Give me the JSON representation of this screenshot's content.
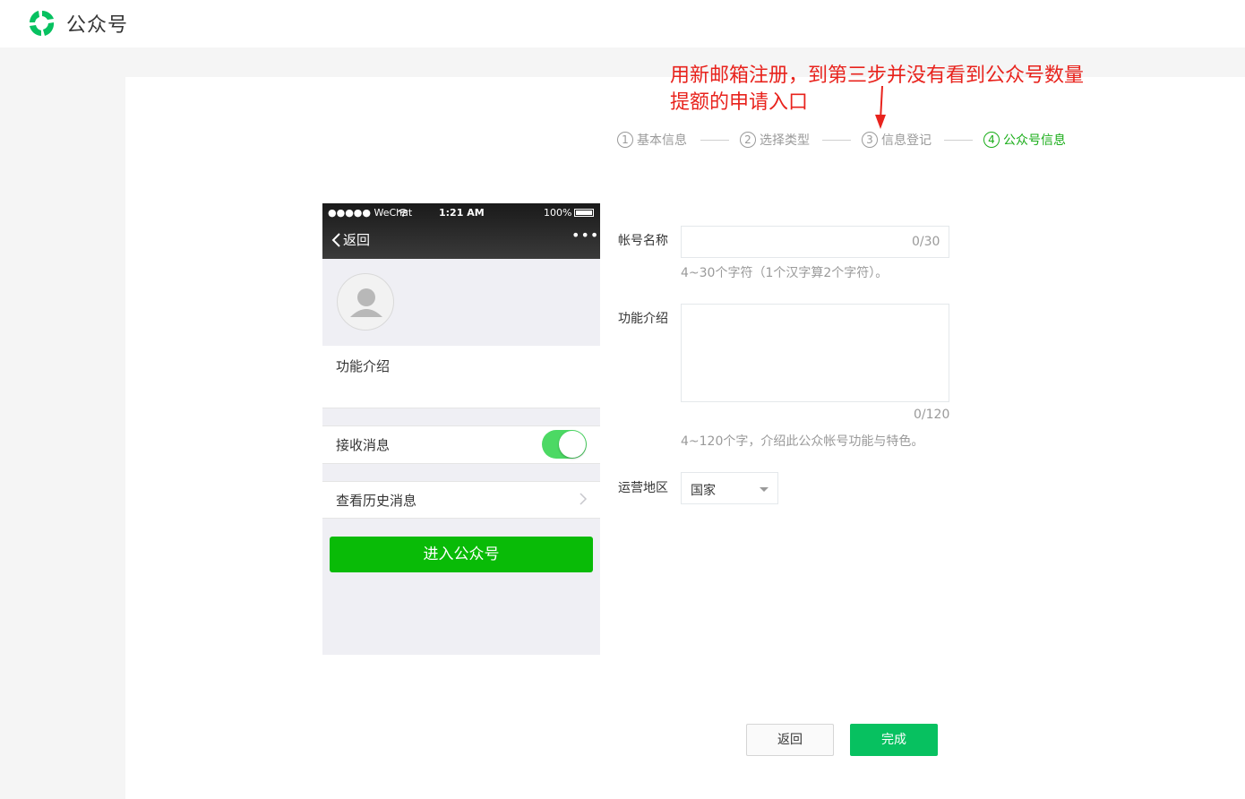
{
  "header": {
    "logo_text": "公众号",
    "logo_icon": "wechat-mp-logo"
  },
  "annotation": {
    "line1": "用新邮箱注册，到第三步并没有看到公众号数量",
    "line2": "提额的申请入口"
  },
  "steps": [
    {
      "num": "1",
      "label": "基本信息",
      "active": false
    },
    {
      "num": "2",
      "label": "选择类型",
      "active": false
    },
    {
      "num": "3",
      "label": "信息登记",
      "active": false
    },
    {
      "num": "4",
      "label": "公众号信息",
      "active": true
    }
  ],
  "phone": {
    "status_left": "●●●●● WeChat",
    "status_time": "1:21 AM",
    "status_battery": "100%",
    "back_label": "返回",
    "more_label": "•••",
    "intro_label": "功能介绍",
    "receive_label": "接收消息",
    "receive_on": true,
    "history_label": "查看历史消息",
    "enter_button": "进入公众号"
  },
  "form": {
    "name_label": "帐号名称",
    "name_value": "",
    "name_counter": "0/30",
    "name_tip": "4~30个字符（1个汉字算2个字符）。",
    "intro_label": "功能介绍",
    "intro_value": "",
    "intro_counter": "0/120",
    "intro_tip": "4~120个字，介绍此公众帐号功能与特色。",
    "region_label": "运营地区",
    "region_value": "国家"
  },
  "actions": {
    "back": "返回",
    "done": "完成"
  },
  "colors": {
    "brand_green": "#07c160",
    "annotation_red": "#e8231d",
    "step_active": "#1aad19"
  }
}
